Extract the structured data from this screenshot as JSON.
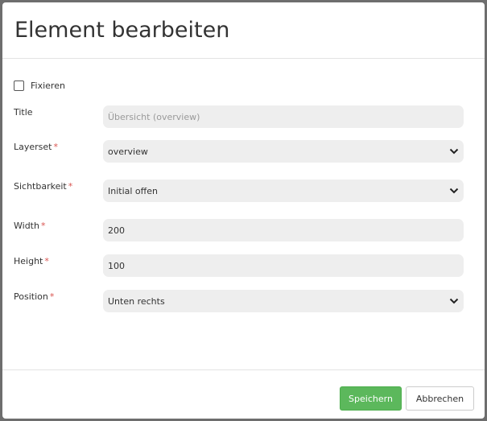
{
  "dialog": {
    "title": "Element bearbeiten",
    "fixieren_label": "Fixieren",
    "fixieren_checked": false
  },
  "fields": {
    "title": {
      "label": "Title",
      "required": false,
      "placeholder": "Übersicht (overview)",
      "value": ""
    },
    "layerset": {
      "label": "Layerset",
      "required": true,
      "value": "overview"
    },
    "sichtbarkeit": {
      "label": "Sichtbarkeit",
      "required": true,
      "value": "Initial offen"
    },
    "width": {
      "label": "Width",
      "required": true,
      "value": "200"
    },
    "height": {
      "label": "Height",
      "required": true,
      "value": "100"
    },
    "position": {
      "label": "Position",
      "required": true,
      "value": "Unten rechts"
    }
  },
  "required_marker": "*",
  "footer": {
    "save_label": "Speichern",
    "cancel_label": "Abbrechen"
  },
  "colors": {
    "save_button": "#5cb85c",
    "required_marker": "#d9534f",
    "field_background": "#eeeeee"
  }
}
